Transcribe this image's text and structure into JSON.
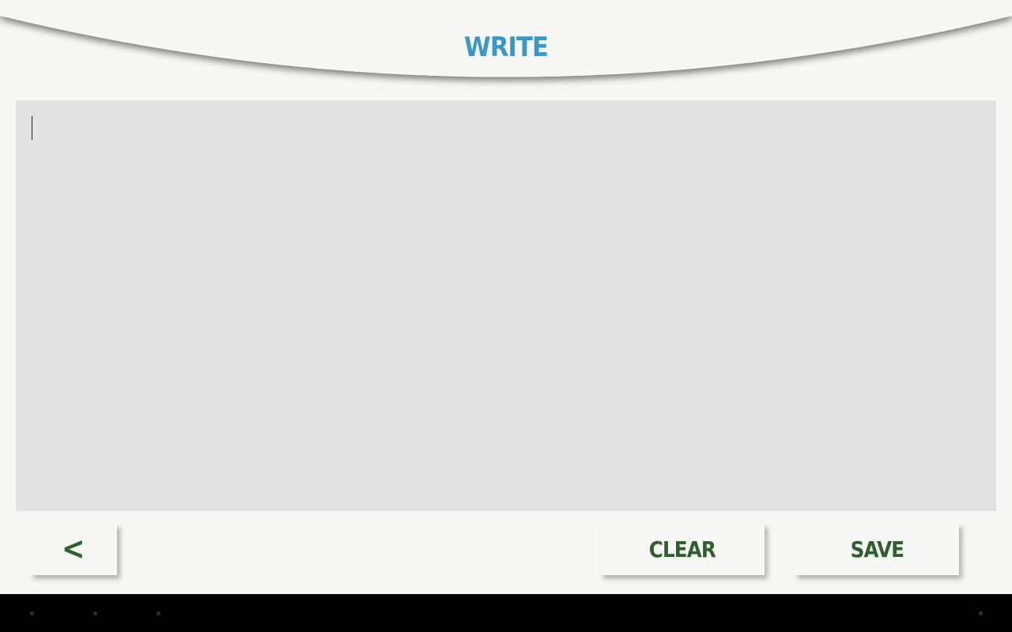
{
  "header": {
    "title": "WRITE"
  },
  "editor": {
    "value": "",
    "placeholder": ""
  },
  "actions": {
    "back_label": "<",
    "clear_label": "CLEAR",
    "save_label": "SAVE"
  },
  "icons": {
    "back": "chevron-left-icon",
    "nav_back": "nav-back-icon",
    "nav_home": "nav-home-icon",
    "nav_recents": "nav-recents-icon",
    "nav_menu": "nav-menu-icon"
  },
  "colors": {
    "title": "#3a98c8",
    "button_text": "#2f5f2c",
    "background": "#f7f7f6",
    "editor_background": "#e2e2e2",
    "navbar": "#000000"
  }
}
